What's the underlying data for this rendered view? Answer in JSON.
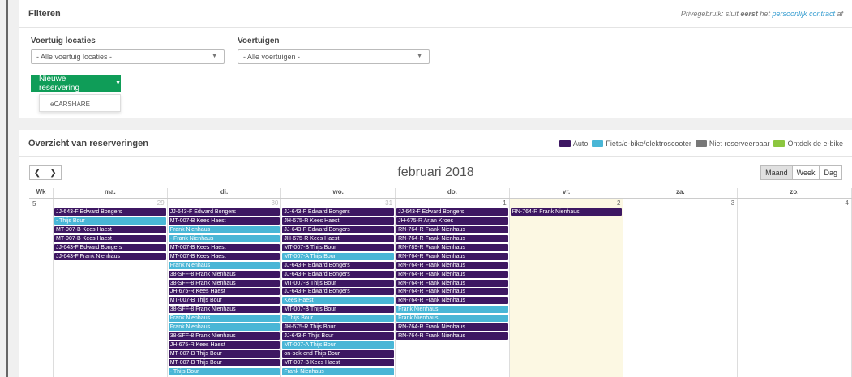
{
  "filters": {
    "title": "Filteren",
    "note_prefix": "Privégebruik: sluit ",
    "note_bold": "eerst",
    "note_mid": " het ",
    "note_link": "persoonlijk contract",
    "note_suffix": " af",
    "location_label": "Voertuig locaties",
    "location_value": "- Alle voertuig locaties -",
    "vehicle_label": "Voertuigen",
    "vehicle_value": "- Alle voertuigen -",
    "new_button": "Nieuwe reservering",
    "dropdown_item": "eCARSHARE"
  },
  "overview": {
    "title": "Overzicht van reserveringen",
    "legend": [
      {
        "label": "Auto",
        "color": "#3d1762"
      },
      {
        "label": "Fiets/e-bike/elektroscooter",
        "color": "#49b6d6"
      },
      {
        "label": "Niet reserveerbaar",
        "color": "#777777"
      },
      {
        "label": "Ontdek de e-bike",
        "color": "#8cc63f"
      }
    ],
    "month_title": "februari 2018",
    "views": [
      "Maand",
      "Week",
      "Dag"
    ],
    "active_view": "Maand",
    "week_col_header": "Wk",
    "day_headers": [
      "ma.",
      "di.",
      "wo.",
      "do.",
      "vr.",
      "za.",
      "zo."
    ],
    "week_number": "5",
    "days": [
      {
        "num": "29",
        "other": true,
        "today": false,
        "events": [
          {
            "t": "JJ-643-F Edward Bongers",
            "c": "auto"
          },
          {
            "t": "- Thijs Bour",
            "c": "fiets"
          },
          {
            "t": "MT-007-B Kees Haest",
            "c": "auto"
          },
          {
            "t": "MT-007-B Kees Haest",
            "c": "auto"
          },
          {
            "t": "JJ-643-F Edward Bongers",
            "c": "auto"
          },
          {
            "t": "JJ-643-F Frank Nienhaus",
            "c": "auto"
          }
        ]
      },
      {
        "num": "30",
        "other": true,
        "today": false,
        "events": [
          {
            "t": "JJ-643-F Edward Bongers",
            "c": "auto"
          },
          {
            "t": "MT-007-B Kees Haest",
            "c": "auto"
          },
          {
            "t": "Frank Nienhaus",
            "c": "fiets"
          },
          {
            "t": "- Frank Nienhaus",
            "c": "fiets"
          },
          {
            "t": "MT-007-B Kees Haest",
            "c": "auto"
          },
          {
            "t": "MT-007-B Kees Haest",
            "c": "auto"
          },
          {
            "t": "Frank Nienhaus",
            "c": "fiets"
          },
          {
            "t": "38-SFF-8 Frank Nienhaus",
            "c": "auto"
          },
          {
            "t": "38-SFF-8 Frank Nienhaus",
            "c": "auto"
          },
          {
            "t": "JH-675-R Kees Haest",
            "c": "auto"
          },
          {
            "t": "MT-007-B Thijs Bour",
            "c": "auto"
          },
          {
            "t": "38-SFF-8 Frank Nienhaus",
            "c": "auto"
          },
          {
            "t": "Frank Nienhaus",
            "c": "fiets"
          },
          {
            "t": "Frank Nienhaus",
            "c": "fiets"
          },
          {
            "t": "38-SFF-8 Frank Nienhaus",
            "c": "auto"
          },
          {
            "t": "JH-675-R Kees Haest",
            "c": "auto"
          },
          {
            "t": "MT-007-B Thijs Bour",
            "c": "auto"
          },
          {
            "t": "MT-007-B Thijs Bour",
            "c": "auto"
          },
          {
            "t": "- Thijs Bour",
            "c": "fiets"
          }
        ]
      },
      {
        "num": "31",
        "other": true,
        "today": false,
        "events": [
          {
            "t": "JJ-643-F Edward Bongers",
            "c": "auto"
          },
          {
            "t": "JH-675-R Kees Haest",
            "c": "auto"
          },
          {
            "t": "JJ-643-F Edward Bongers",
            "c": "auto"
          },
          {
            "t": "JH-675-R Kees Haest",
            "c": "auto"
          },
          {
            "t": "MT-007-B Thijs Bour",
            "c": "auto"
          },
          {
            "t": "MT-007-A Thijs Bour",
            "c": "fiets"
          },
          {
            "t": "JJ-643-F Edward Bongers",
            "c": "auto"
          },
          {
            "t": "JJ-643-F Edward Bongers",
            "c": "auto"
          },
          {
            "t": "MT-007-B Thijs Bour",
            "c": "auto"
          },
          {
            "t": "JJ-643-F Edward Bongers",
            "c": "auto"
          },
          {
            "t": "Kees Haest",
            "c": "fiets"
          },
          {
            "t": "MT-007-B Thijs Bour",
            "c": "auto"
          },
          {
            "t": "- Thijs Bour",
            "c": "fiets"
          },
          {
            "t": "JH-675-R Thijs Bour",
            "c": "auto"
          },
          {
            "t": "JJ-643-F Thijs Bour",
            "c": "auto"
          },
          {
            "t": "MT-007-A Thijs Bour",
            "c": "fiets"
          },
          {
            "t": "on-bek-end Thijs Bour",
            "c": "auto"
          },
          {
            "t": "MT-007-B Kees Haest",
            "c": "auto"
          },
          {
            "t": "Frank Nienhaus",
            "c": "fiets"
          }
        ]
      },
      {
        "num": "1",
        "other": false,
        "today": false,
        "events": [
          {
            "t": "JJ-643-F Edward Bongers",
            "c": "auto"
          },
          {
            "t": "JH-675-R Arjan Kroes",
            "c": "auto"
          },
          {
            "t": "RN-764-R Frank Nienhaus",
            "c": "auto"
          },
          {
            "t": "RN-764-R Frank Nienhaus",
            "c": "auto"
          },
          {
            "t": "RN-789-R Frank Nienhaus",
            "c": "auto"
          },
          {
            "t": "RN-764-R Frank Nienhaus",
            "c": "auto"
          },
          {
            "t": "RN-764-R Frank Nienhaus",
            "c": "auto"
          },
          {
            "t": "RN-764-R Frank Nienhaus",
            "c": "auto"
          },
          {
            "t": "RN-764-R Frank Nienhaus",
            "c": "auto"
          },
          {
            "t": "RN-764-R Frank Nienhaus",
            "c": "auto"
          },
          {
            "t": "RN-764-R Frank Nienhaus",
            "c": "auto"
          },
          {
            "t": "Frank Nienhaus",
            "c": "fiets"
          },
          {
            "t": "Frank Nienhaus",
            "c": "fiets"
          },
          {
            "t": "RN-764-R Frank Nienhaus",
            "c": "auto"
          },
          {
            "t": "RN-764-R Frank Nienhaus",
            "c": "auto"
          }
        ]
      },
      {
        "num": "2",
        "other": false,
        "today": true,
        "events": [
          {
            "t": "RN-764-R Frank Nienhaus",
            "c": "auto"
          }
        ]
      },
      {
        "num": "3",
        "other": false,
        "today": false,
        "events": []
      },
      {
        "num": "4",
        "other": false,
        "today": false,
        "events": []
      }
    ]
  }
}
